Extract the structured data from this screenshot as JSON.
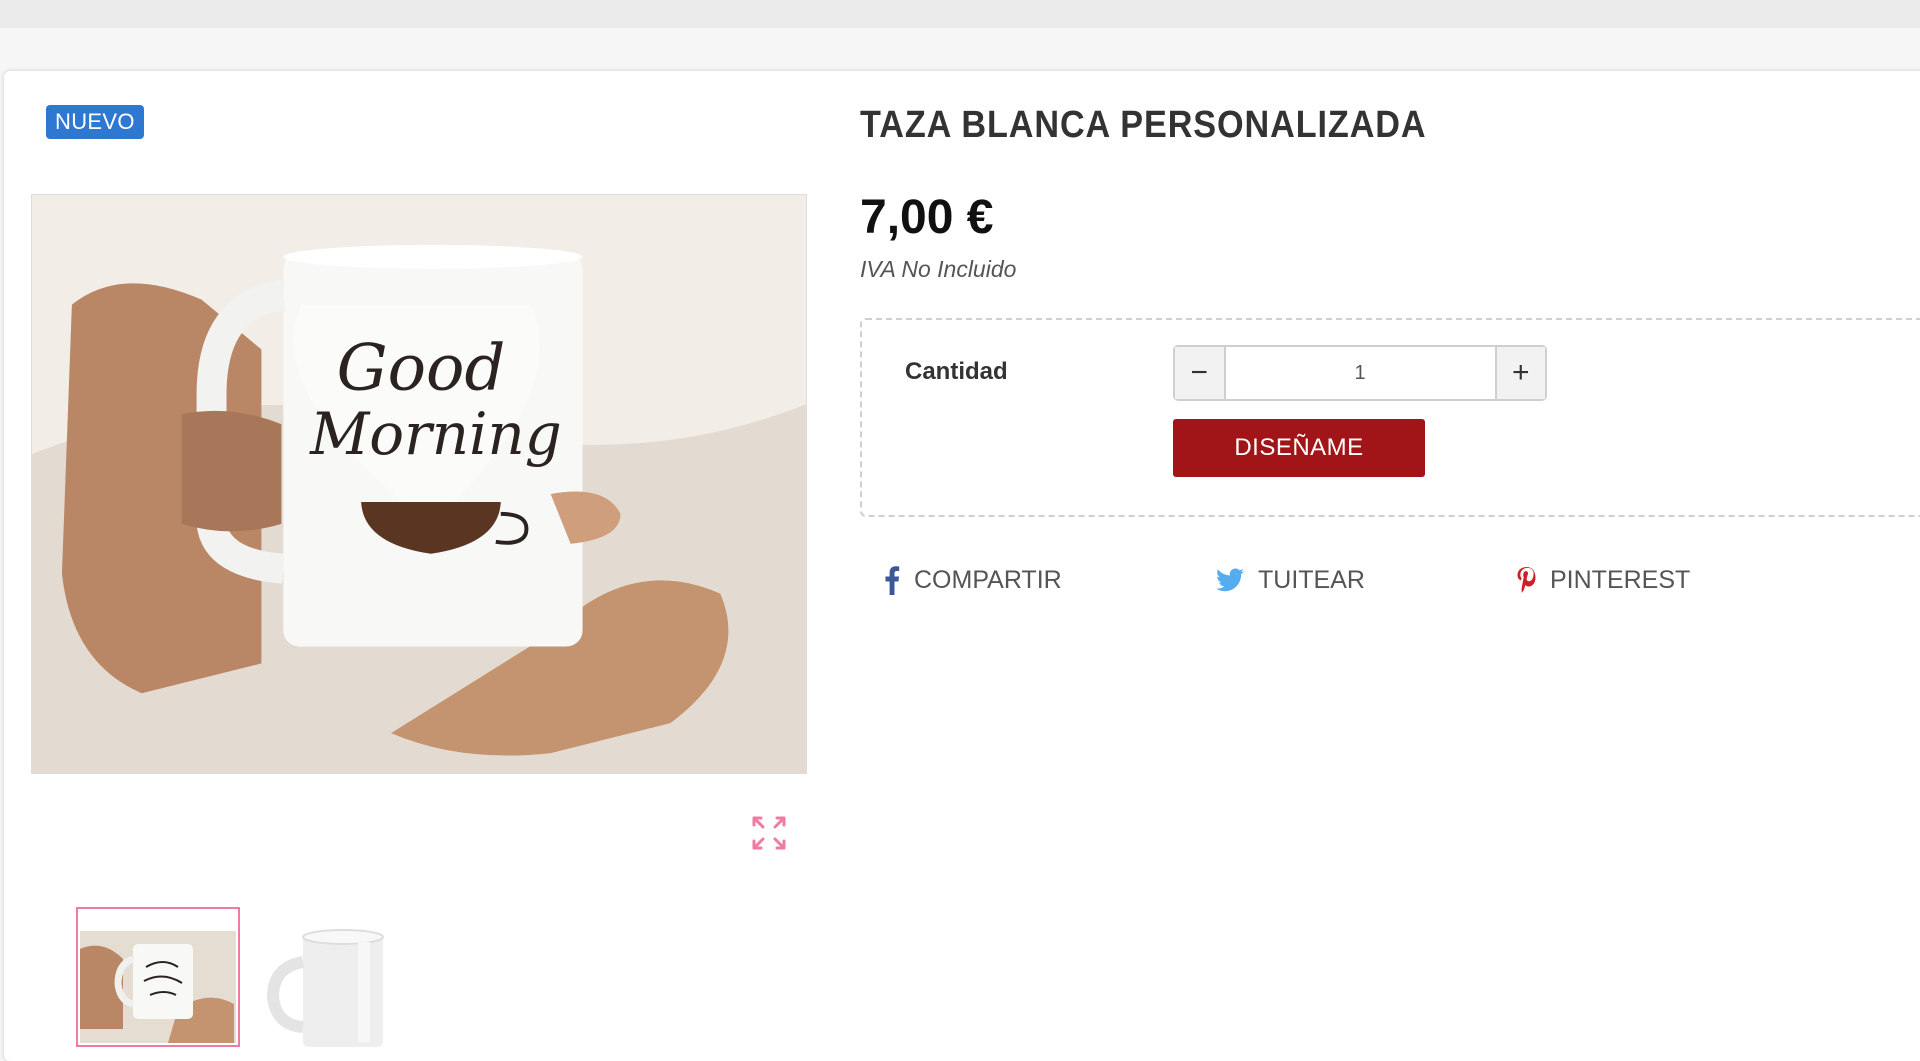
{
  "product": {
    "badge": "NUEVO",
    "title": "TAZA BLANCA PERSONALIZADA",
    "price": "7,00 €",
    "tax_note": "IVA No Incluido"
  },
  "purchase": {
    "quantity_label": "Cantidad",
    "quantity_value": "1",
    "decrement_symbol": "−",
    "increment_symbol": "+",
    "design_button": "DISEÑAME"
  },
  "share": {
    "facebook": "COMPARTIR",
    "twitter": "TUITEAR",
    "pinterest": "PINTEREST"
  },
  "images": {
    "mug_print": [
      "Good",
      "Morning"
    ]
  },
  "icons": {
    "facebook": "facebook-icon",
    "twitter": "twitter-icon",
    "pinterest": "pinterest-icon",
    "expand": "expand-icon"
  },
  "colors": {
    "badge": "#2f78d2",
    "design_button": "#a11519",
    "facebook": "#3b5998",
    "twitter": "#55acee",
    "pinterest": "#cb2027",
    "expand": "#f07aa0",
    "selected_thumb": "#f07aa0"
  }
}
